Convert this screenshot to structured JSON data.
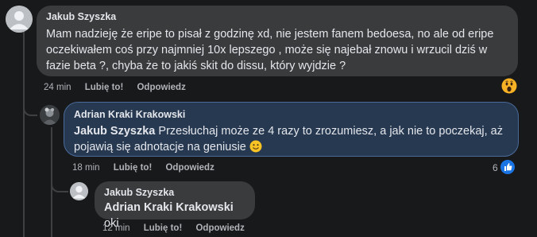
{
  "comments": [
    {
      "author": "Jakub Szyszka",
      "text": "Mam nadzieję że eripe to pisał z godzinę xd, nie jestem fanem bedoesa, no ale od eripe oczekiwałem coś przy najmniej 10x lepszego , może się najebał znowu i wrzucil dziś w fazie beta ?, chyba że to jakiś skit do dissu, który wyjdzie ?",
      "time": "24 min",
      "like_label": "Lubię to!",
      "reply_label": "Odpowiedz",
      "reaction_icon": "wow-emoji-icon"
    },
    {
      "author": "Adrian Kraki Krakowski",
      "mention": "Jakub Szyszka",
      "text": "Przesłuchaj może ze 4 razy to zrozumiesz, a jak nie to poczekaj, aż pojawią się adnotacje na geniusie",
      "emoji_icon": "smile-emoji-icon",
      "time": "18 min",
      "like_label": "Lubię to!",
      "reply_label": "Odpowiedz",
      "like_count": "6",
      "highlight_color": "#263951"
    },
    {
      "author": "Jakub Szyszka",
      "mention": "Adrian Kraki Krakowski",
      "text": "oki",
      "time": "12 min",
      "like_label": "Lubię to!",
      "reply_label": "Odpowiedz"
    }
  ],
  "colors": {
    "background": "#18191a",
    "bubble": "#3a3b3c",
    "like_blue": "#1b74e4",
    "secondary_text": "#b0b3b8"
  }
}
